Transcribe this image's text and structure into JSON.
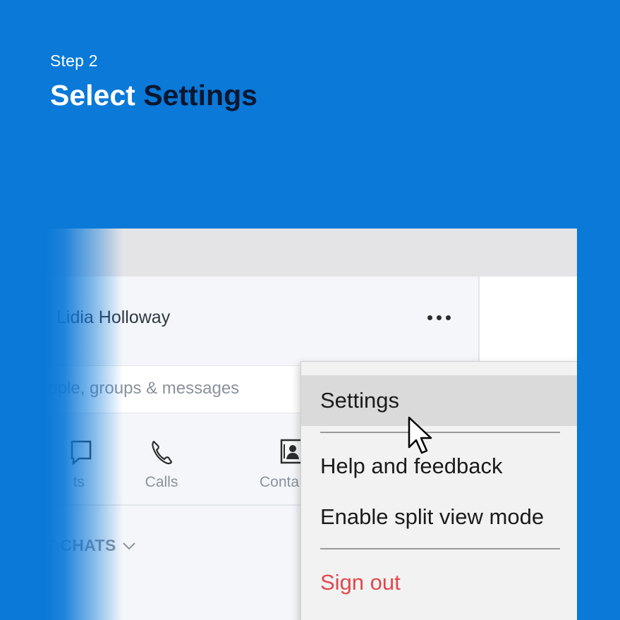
{
  "step": {
    "label": "Step 2",
    "title_prefix": "Select ",
    "title_highlight": "Settings"
  },
  "colors": {
    "background": "#0a79d8",
    "title_highlight": "#0b1730",
    "danger": "#e2474b"
  },
  "app": {
    "user_name": "Lidia Holloway",
    "more_icon": "more-horizontal-icon",
    "search": {
      "placeholder": "eople, groups & messages"
    },
    "tabs": [
      {
        "label": "ts",
        "icon": "chat-icon"
      },
      {
        "label": "Calls",
        "icon": "phone-icon"
      },
      {
        "label": "Conta",
        "icon": "contacts-icon"
      }
    ],
    "section": {
      "label": "T CHATS",
      "icon": "chevron-down-icon"
    }
  },
  "menu": {
    "items": [
      {
        "label": "Settings",
        "selected": true
      },
      {
        "label": "Help and feedback"
      },
      {
        "label": "Enable split view mode"
      },
      {
        "label": "Sign out",
        "danger": true
      }
    ]
  }
}
